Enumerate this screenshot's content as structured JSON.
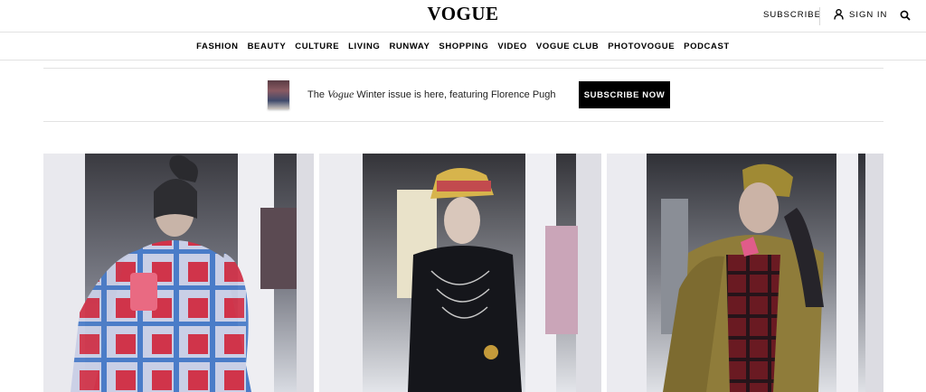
{
  "header": {
    "logo": "VOGUE",
    "subscribe_label": "SUBSCRIBE",
    "signin_label": "SIGN IN",
    "icons": {
      "account": "user-icon",
      "search": "search-icon"
    }
  },
  "nav": {
    "items": [
      "FASHION",
      "BEAUTY",
      "CULTURE",
      "LIVING",
      "RUNWAY",
      "SHOPPING",
      "VIDEO",
      "VOGUE CLUB",
      "PHOTOVOGUE",
      "PODCAST"
    ]
  },
  "promo": {
    "text_prefix": "The ",
    "text_italic": "Vogue",
    "text_suffix": " Winter issue is here, featuring Florence Pugh",
    "button_label": "SUBSCRIBE NOW"
  },
  "gallery": {
    "photos": [
      {
        "subject": "runway look in blue and red checked cape with pink clutch"
      },
      {
        "subject": "runway look in black jacket with chains and decorated bucket hat"
      },
      {
        "subject": "runway look in olive distressed coat with red plaid and gold hat"
      }
    ]
  },
  "colors": {
    "accent": "#000000",
    "button_text": "#ffffff",
    "divider": "#e2e2e2"
  }
}
